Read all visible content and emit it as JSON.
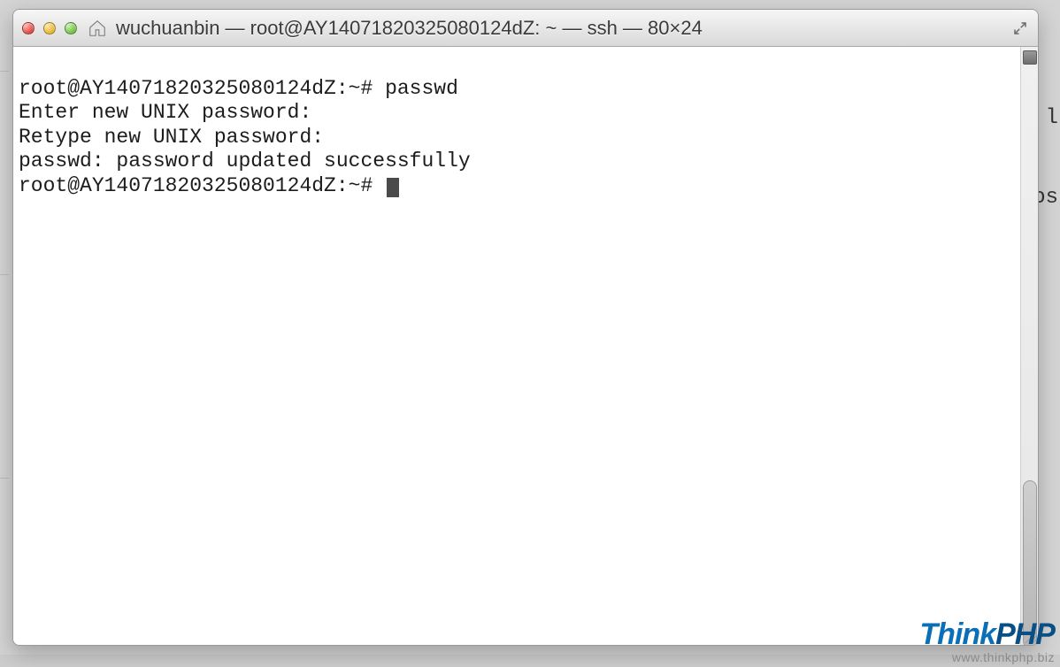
{
  "window": {
    "title": "wuchuanbin — root@AY14071820325080124dZ: ~ — ssh — 80×24"
  },
  "terminal": {
    "lines": [
      "root@AY14071820325080124dZ:~# passwd",
      "Enter new UNIX password:",
      "Retype new UNIX password:",
      "passwd: password updated successfully"
    ],
    "prompt": "root@AY14071820325080124dZ:~# "
  },
  "background": {
    "frag1": "l",
    "frag2": "os"
  },
  "watermark": {
    "brand_part1": "Think",
    "brand_part2": "PHP",
    "url": "www.thinkphp.biz"
  }
}
